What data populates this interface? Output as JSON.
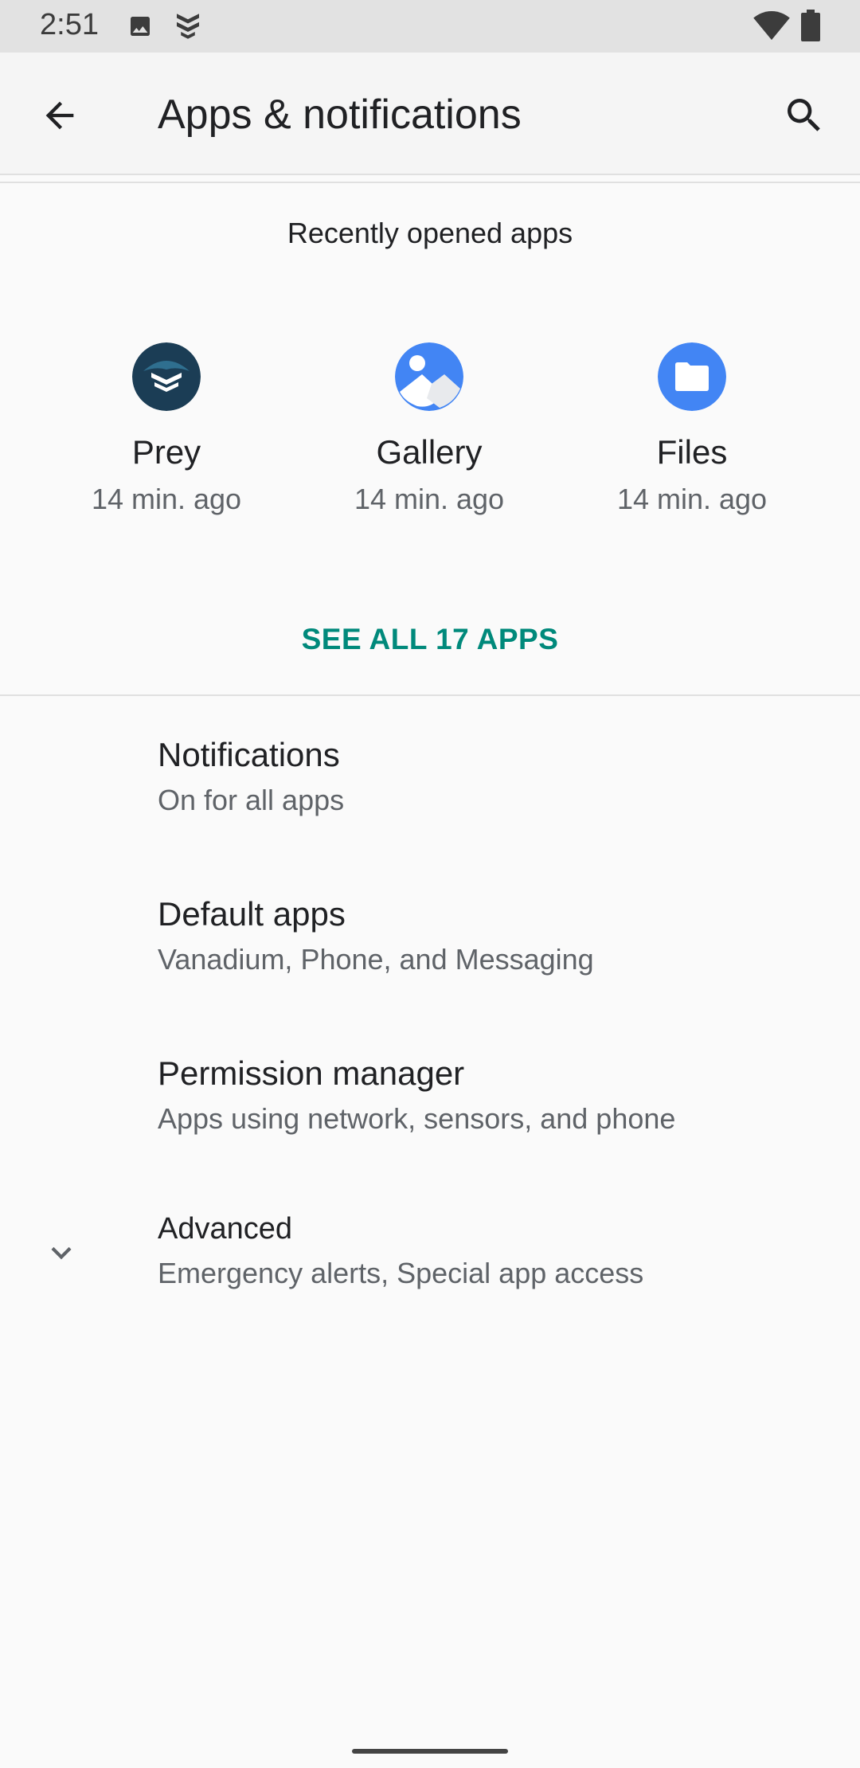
{
  "status_bar": {
    "time": "2:51",
    "left_icons": [
      "image-icon",
      "prey-status-icon"
    ],
    "right_icons": [
      "wifi-icon",
      "battery-icon"
    ]
  },
  "app_bar": {
    "title": "Apps & notifications",
    "back_icon": "arrow-back-icon",
    "search_icon": "search-icon"
  },
  "recent": {
    "header": "Recently opened apps",
    "apps": [
      {
        "name": "Prey",
        "time": "14 min. ago",
        "icon": "prey-icon",
        "color": "#1b3d55"
      },
      {
        "name": "Gallery",
        "time": "14 min. ago",
        "icon": "gallery-icon",
        "color": "#4285f4"
      },
      {
        "name": "Files",
        "time": "14 min. ago",
        "icon": "files-icon",
        "color": "#4285f4"
      }
    ],
    "see_all": "SEE ALL 17 APPS"
  },
  "settings": [
    {
      "title": "Notifications",
      "summary": "On for all apps"
    },
    {
      "title": "Default apps",
      "summary": "Vanadium, Phone, and Messaging"
    },
    {
      "title": "Permission manager",
      "summary": "Apps using network, sensors, and phone"
    },
    {
      "title": "Advanced",
      "summary": "Emergency alerts, Special app access",
      "icon": "chevron-down-icon"
    }
  ],
  "colors": {
    "accent": "#00897b",
    "status_bar_bg": "#e2e2e2",
    "app_bar_bg": "#f5f5f5",
    "page_bg": "#fafafa"
  }
}
